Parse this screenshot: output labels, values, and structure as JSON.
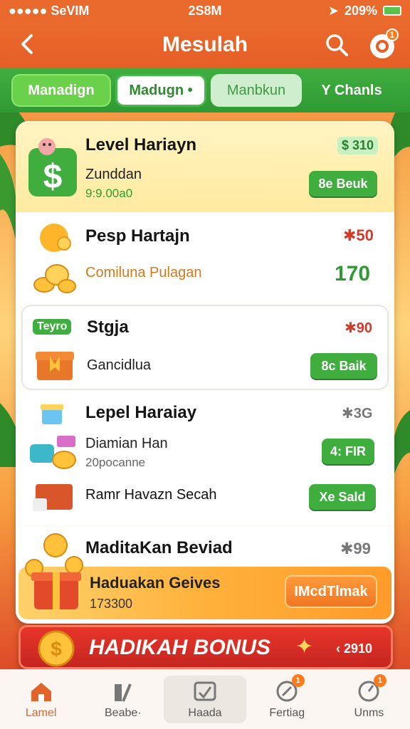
{
  "status_bar": {
    "carrier": "●●●●● SeVIM",
    "time": "2S8M",
    "battery": "209%"
  },
  "header": {
    "title": "Mesulah",
    "notification_count": "1"
  },
  "tabs": [
    {
      "label": "Manadign"
    },
    {
      "label": "Madugn •"
    },
    {
      "label": "Manbkun"
    },
    {
      "label": "Y Chanls"
    }
  ],
  "rows": {
    "level": {
      "title": "Level Hariayn",
      "subtitle": "Zunddan",
      "detail": "9:9.00a0",
      "reward": "$ 310",
      "button": "8e Beuk"
    },
    "pesp": {
      "title": "Pesp Hartajn",
      "reward": "✱50",
      "item2": "Comiluna Pulagan",
      "item2_value": "170"
    },
    "stgja": {
      "tag": "Teyro",
      "title": "Stgja",
      "reward": "✱90",
      "item2": "Gancidlua",
      "button": "8c Baik"
    },
    "lepel": {
      "title": "Lepel Haraiay",
      "reward": "✱3G",
      "item2": "Diamian Han",
      "item2_detail": "20pocanne",
      "item2_button": "4: FIR",
      "item3": "Ramr Havazn Secah",
      "item3_button": "Xe Sald"
    },
    "maditakan": {
      "title": "MaditaKan Beviad",
      "reward": "✱99",
      "banner_title": "Haduakan Geives",
      "banner_value": "173300",
      "banner_button": "IMcdTlmak"
    }
  },
  "bonus": {
    "label": "HADIKAH BONUS",
    "value": "‹ 2910"
  },
  "bottom_nav": [
    {
      "label": "Lamel"
    },
    {
      "label": "Beabe·"
    },
    {
      "label": "Haada"
    },
    {
      "label": "Fertiag",
      "badge": "1"
    },
    {
      "label": "Unms",
      "badge": "1"
    }
  ]
}
